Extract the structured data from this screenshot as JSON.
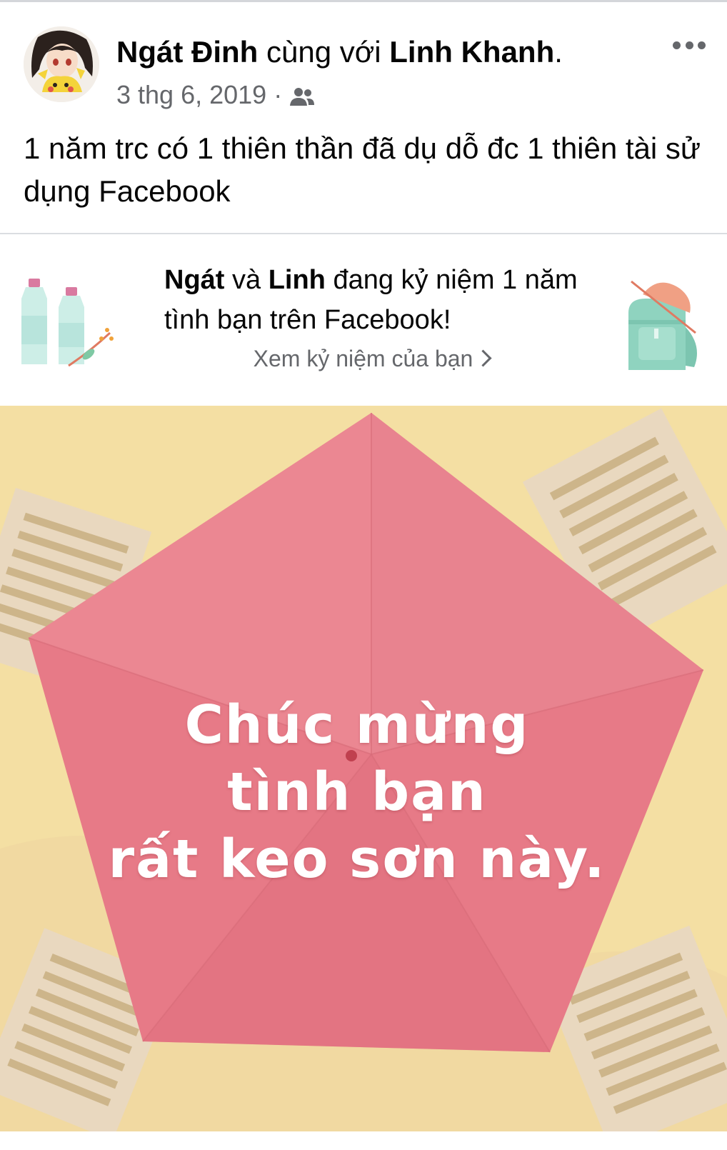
{
  "post": {
    "author_name": "Ngát Đinh",
    "with_text": " cùng với ",
    "tagged_name": "Linh Khanh",
    "tagged_suffix": ".",
    "date": "3 thg 6, 2019",
    "separator": "·",
    "audience_icon": "friends-icon",
    "body": "1 năm trc có 1 thiên thần đã dụ dỗ đc 1 thiên tài sử dụng Facebook",
    "more_icon": "more-dots-icon"
  },
  "memory_card": {
    "name_1": "Ngát",
    "joiner": " và ",
    "name_2": "Linh",
    "title_rest": " đang kỷ niệm 1 năm tình bạn trên Facebook!",
    "link_label": "Xem kỷ niệm của bạn",
    "left_icon": "water-bottles-icon",
    "right_icon": "backpack-icon"
  },
  "memory_image": {
    "line_1": "Chúc mừng",
    "line_2": "tình bạn",
    "line_3": "rất keo sơn này.",
    "colors": {
      "background": "#f4dfa3",
      "pentagon": "#e77a87",
      "paper": "#e9d8bf"
    }
  }
}
